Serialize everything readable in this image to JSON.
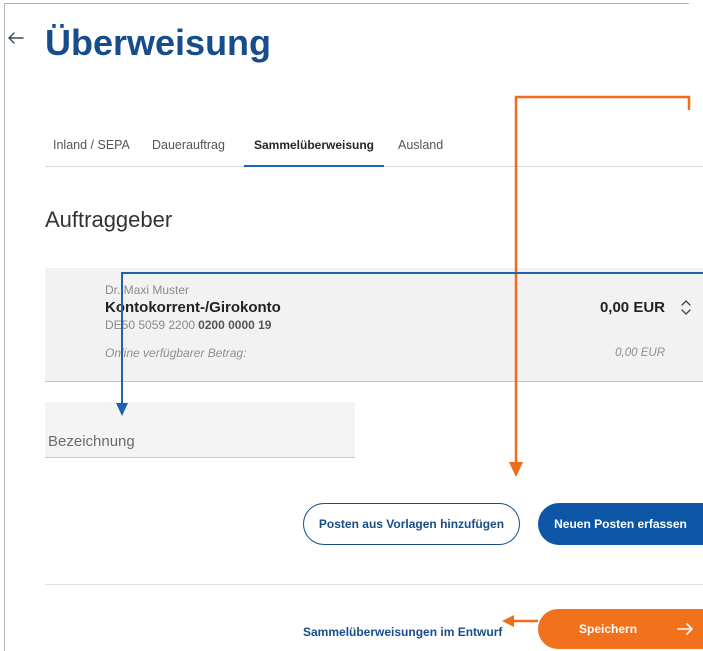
{
  "header": {
    "back_icon": "arrow-left-icon",
    "title": "Überweisung"
  },
  "tabs": {
    "items": [
      "Inland / SEPA",
      "Dauerauftrag",
      "Sammelüberweisung",
      "Ausland"
    ],
    "active_index": 2
  },
  "section": {
    "title": "Auftraggeber"
  },
  "account": {
    "holder": "Dr. Maxi Muster",
    "name": "Kontokorrent-/Girokonto",
    "iban_prefix": "DE50 5059 2200",
    "iban_account_number": "0200 0000 19",
    "balance": "0,00 EUR",
    "available_label": "Online verfügbarer Betrag:",
    "available_value": "0,00 EUR",
    "toggle_icon": "chevron-up-down-icon"
  },
  "description_field": {
    "placeholder": "Bezeichnung"
  },
  "actions": {
    "add_from_templates": "Posten aus Vorlagen hinzufügen",
    "new_item": "Neuen Posten erfassen"
  },
  "footer": {
    "drafts_link": "Sammelüberweisungen im Entwurf",
    "save_label": "Speichern",
    "save_icon": "arrow-right-icon"
  },
  "colors": {
    "primary": "#164d8a",
    "button_blue": "#0c56a5",
    "accent_orange": "#f2711d",
    "annotation_orange": "#f06b1c",
    "annotation_blue": "#1e63ad"
  }
}
